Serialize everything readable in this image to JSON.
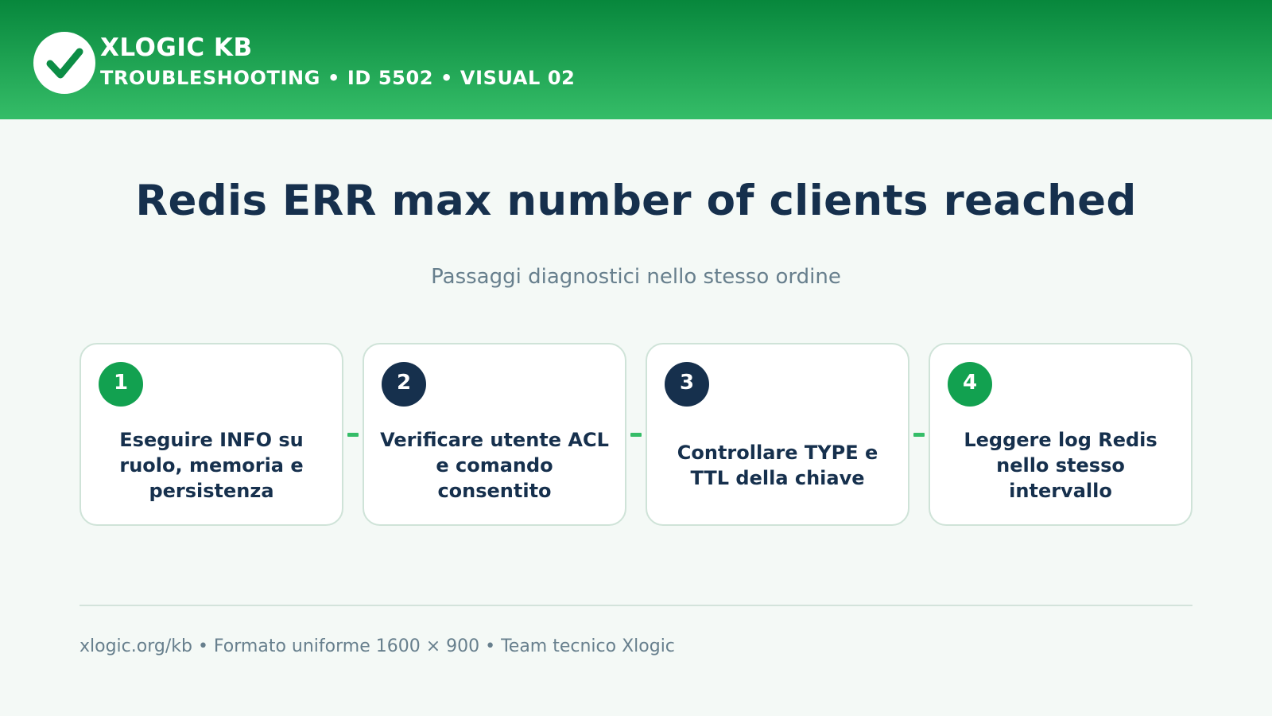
{
  "header": {
    "brand": "XLOGIC KB",
    "subline": "TROUBLESHOOTING • ID 5502 • VISUAL 02",
    "logo_icon": "check-icon"
  },
  "title": "Redis ERR max number of clients reached",
  "subtitle": "Passaggi diagnostici nello stesso ordine",
  "steps": [
    {
      "number": "1",
      "text": "Eseguire INFO su ruolo, memoria e persistenza",
      "badge_color": "#12a150"
    },
    {
      "number": "2",
      "text": "Verificare utente ACL e comando consentito",
      "badge_color": "#16304d"
    },
    {
      "number": "3",
      "text": "Controllare TYPE e TTL della chiave",
      "badge_color": "#16304d"
    },
    {
      "number": "4",
      "text": "Leggere log Redis nello stesso intervallo",
      "badge_color": "#12a150"
    }
  ],
  "footer": "xlogic.org/kb • Formato uniforme 1600 × 900 • Team tecnico Xlogic",
  "colors": {
    "header_top": "#07873c",
    "header_bottom": "#35bd68",
    "title": "#16304d",
    "muted": "#677f8d",
    "connector": "#35bd68",
    "card_border": "#cfe3d8"
  }
}
